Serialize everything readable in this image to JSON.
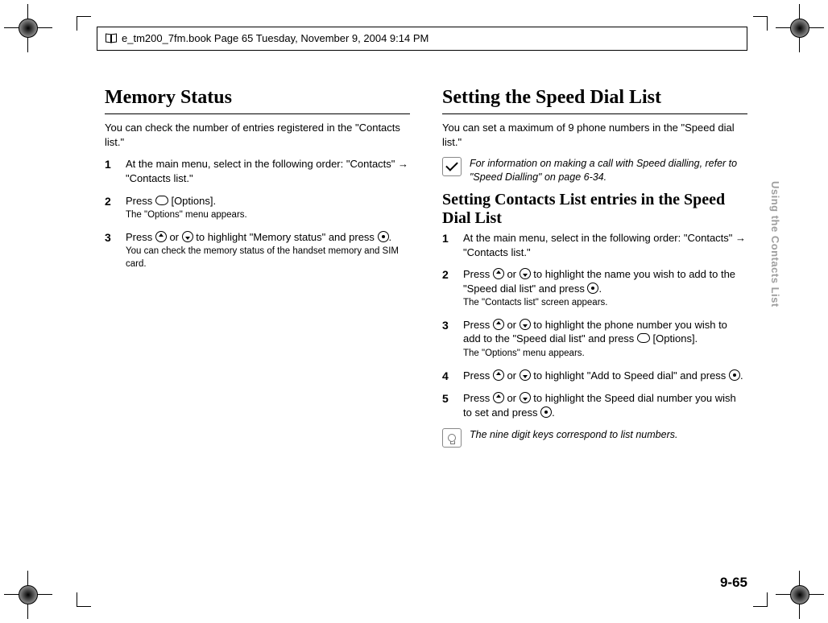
{
  "running_header": "e_tm200_7fm.book  Page 65  Tuesday, November 9, 2004  9:14 PM",
  "side_tab": "Using the Contacts List",
  "page_number": "9-65",
  "left": {
    "heading": "Memory Status",
    "intro": "You can check the number of entries registered in the \"Contacts list.\"",
    "steps": [
      {
        "n": "1",
        "text_a": "At the main menu, select in the following order: \"Contacts\" ",
        "arrow": "→",
        "text_b": " \"Contacts list.\""
      },
      {
        "n": "2",
        "text_a": "Press ",
        "key1": "softc",
        "text_b": " [Options].",
        "sub": "The \"Options\" menu appears."
      },
      {
        "n": "3",
        "text_a": "Press ",
        "key1": "up",
        "mid": " or ",
        "key2": "down",
        "text_b": " to highlight \"Memory status\" and press ",
        "key3": "center",
        "text_c": ".",
        "sub": "You can check the memory status of the handset memory and SIM card."
      }
    ]
  },
  "right": {
    "heading": "Setting the Speed Dial List",
    "intro": "You can set a maximum of 9 phone numbers in the \"Speed dial list.\"",
    "note1": "For information on making a call with Speed dialling, refer to \"Speed Dialling\" on page 6-34.",
    "subheading": "Setting Contacts List entries in the Speed Dial List",
    "steps": [
      {
        "n": "1",
        "text_a": "At the main menu, select in the following order: \"Contacts\" ",
        "arrow": "→",
        "text_b": " \"Contacts list.\""
      },
      {
        "n": "2",
        "text_a": "Press ",
        "key1": "up",
        "mid": " or ",
        "key2": "down",
        "text_b": " to highlight the name you wish to add to the \"Speed dial list\" and press ",
        "key3": "center",
        "text_c": ".",
        "sub": "The \"Contacts list\" screen appears."
      },
      {
        "n": "3",
        "text_a": "Press ",
        "key1": "up",
        "mid": " or ",
        "key2": "down",
        "text_b": " to highlight the phone number you wish to add to the \"Speed dial list\" and press ",
        "key3": "softc",
        "text_c": " [Options].",
        "sub": "The \"Options\" menu appears."
      },
      {
        "n": "4",
        "text_a": "Press ",
        "key1": "up",
        "mid": " or ",
        "key2": "down",
        "text_b": " to highlight \"Add to Speed dial\" and press ",
        "key3": "center",
        "text_c": "."
      },
      {
        "n": "5",
        "text_a": "Press ",
        "key1": "up",
        "mid": " or ",
        "key2": "down",
        "text_b": " to highlight the Speed dial number you wish to set and press ",
        "key3": "center",
        "text_c": "."
      }
    ],
    "note2": "The nine digit keys correspond to list numbers."
  }
}
